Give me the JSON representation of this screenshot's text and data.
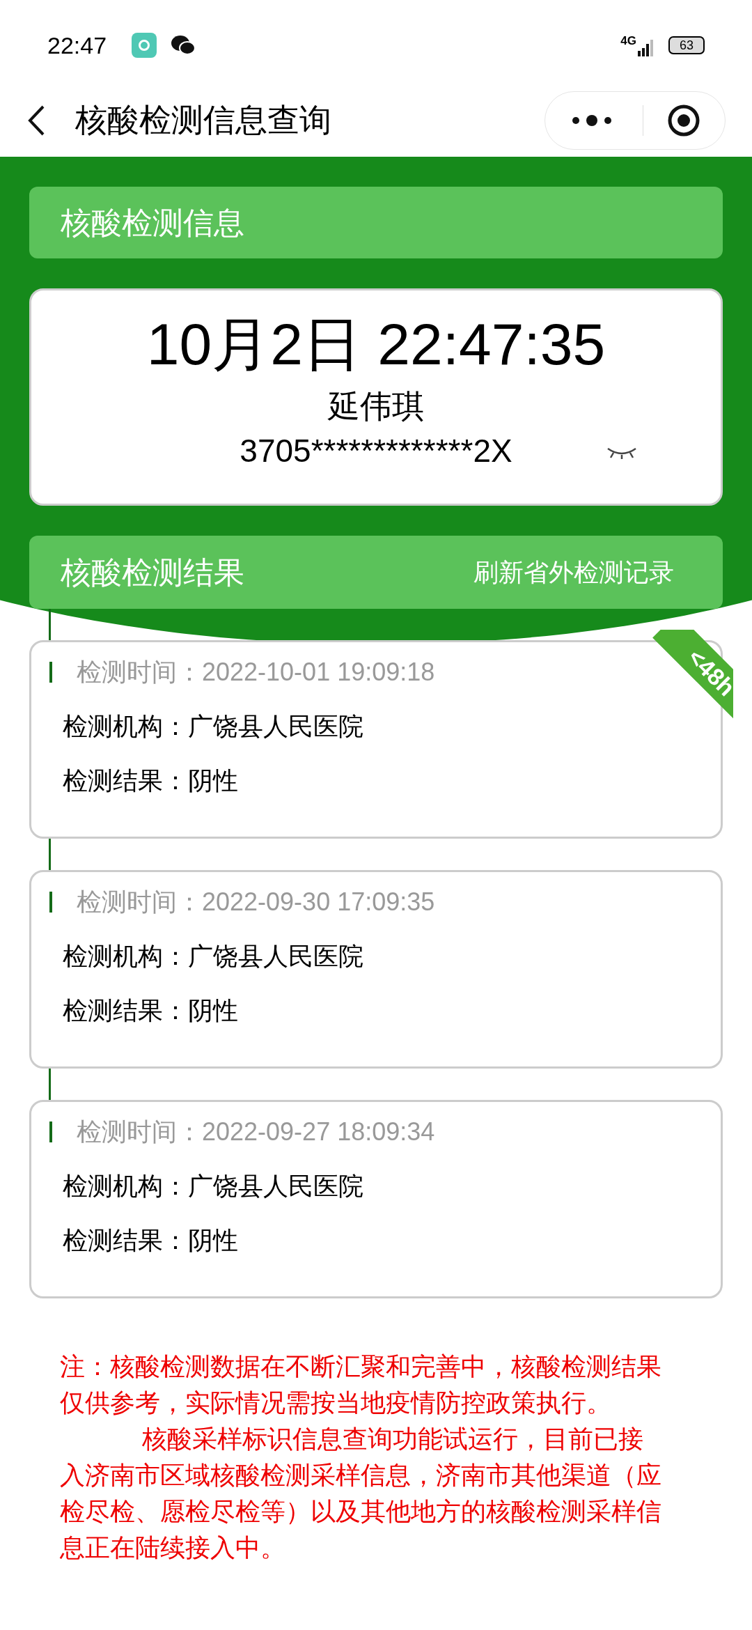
{
  "status_bar": {
    "time": "22:47",
    "network": "4G",
    "battery": "63"
  },
  "nav": {
    "title": "核酸检测信息查询"
  },
  "info_section": {
    "title": "核酸检测信息",
    "datetime": "10月2日 22:47:35",
    "name": "延伟琪",
    "id_number": "3705*************2X"
  },
  "results_section": {
    "title": "核酸检测结果",
    "refresh_link": "刷新省外检测记录"
  },
  "records": [
    {
      "time_label": "检测时间：",
      "time": "2022-10-01 19:09:18",
      "org_label": "检测机构：",
      "org": "广饶县人民医院",
      "result_label": "检测结果：",
      "result": "阴性",
      "badge": "<48h"
    },
    {
      "time_label": "检测时间：",
      "time": "2022-09-30 17:09:35",
      "org_label": "检测机构：",
      "org": "广饶县人民医院",
      "result_label": "检测结果：",
      "result": "阴性"
    },
    {
      "time_label": "检测时间：",
      "time": "2022-09-27 18:09:34",
      "org_label": "检测机构：",
      "org": "广饶县人民医院",
      "result_label": "检测结果：",
      "result": "阴性"
    }
  ],
  "notes": [
    "注：核酸检测数据在不断汇聚和完善中，核酸检测结果仅供参考，实际情况需按当地疫情防控政策执行。",
    "核酸采样标识信息查询功能试运行，目前已接入济南市区域核酸检测采样信息，济南市其他渠道（应检尽检、愿检尽检等）以及其他地方的核酸检测采样信息正在陆续接入中。"
  ]
}
